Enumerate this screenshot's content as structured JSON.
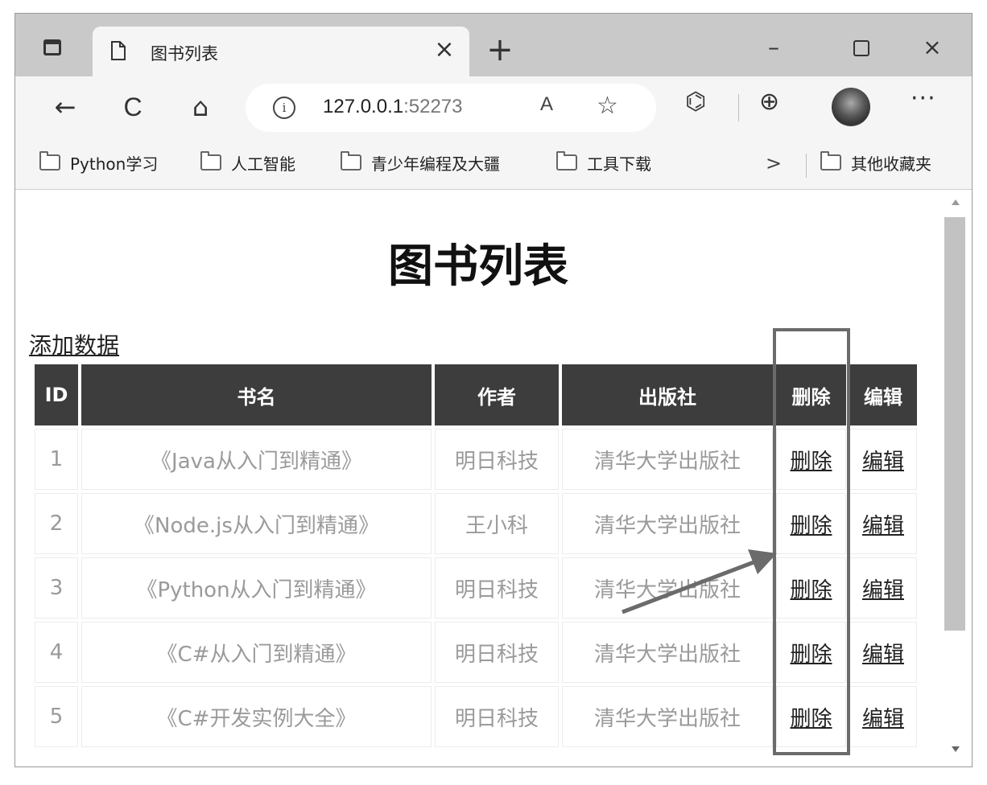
{
  "browser": {
    "tab": {
      "title": "图书列表",
      "close_glyph": "×"
    },
    "new_tab_glyph": "+",
    "window_controls": {
      "minimize_glyph": "–",
      "close_glyph": "×"
    },
    "address": {
      "host": "127.0.0.1",
      "port": ":52273",
      "read_aloud_glyph": "A",
      "info_glyph": "i"
    },
    "nav_icons": {
      "back": "←",
      "refresh": "C",
      "home": "⌂",
      "favorite": "☆",
      "extensions": "⌬",
      "collections": "⊕",
      "more": "···"
    },
    "bookmarks": [
      {
        "label": "Python学习"
      },
      {
        "label": "人工智能"
      },
      {
        "label": "青少年编程及大疆"
      },
      {
        "label": "工具下载"
      }
    ],
    "bookmarks_more_glyph": ">",
    "other_bookmarks": "其他收藏夹"
  },
  "page": {
    "title": "图书列表",
    "add_link": "添加数据",
    "table": {
      "headers": [
        "ID",
        "书名",
        "作者",
        "出版社",
        "删除",
        "编辑"
      ],
      "rows": [
        {
          "id": "1",
          "name": "《Java从入门到精通》",
          "author": "明日科技",
          "publisher": "清华大学出版社",
          "delete": "删除",
          "edit": "编辑"
        },
        {
          "id": "2",
          "name": "《Node.js从入门到精通》",
          "author": "王小科",
          "publisher": "清华大学出版社",
          "delete": "删除",
          "edit": "编辑"
        },
        {
          "id": "3",
          "name": "《Python从入门到精通》",
          "author": "明日科技",
          "publisher": "清华大学出版社",
          "delete": "删除",
          "edit": "编辑"
        },
        {
          "id": "4",
          "name": "《C#从入门到精通》",
          "author": "明日科技",
          "publisher": "清华大学出版社",
          "delete": "删除",
          "edit": "编辑"
        },
        {
          "id": "5",
          "name": "《C#开发实例大全》",
          "author": "明日科技",
          "publisher": "清华大学出版社",
          "delete": "删除",
          "edit": "编辑"
        }
      ]
    }
  },
  "colors": {
    "header_bg": "#3d3d3d",
    "cell_text": "#9a9a9a",
    "annotation": "#6b6b6b"
  }
}
